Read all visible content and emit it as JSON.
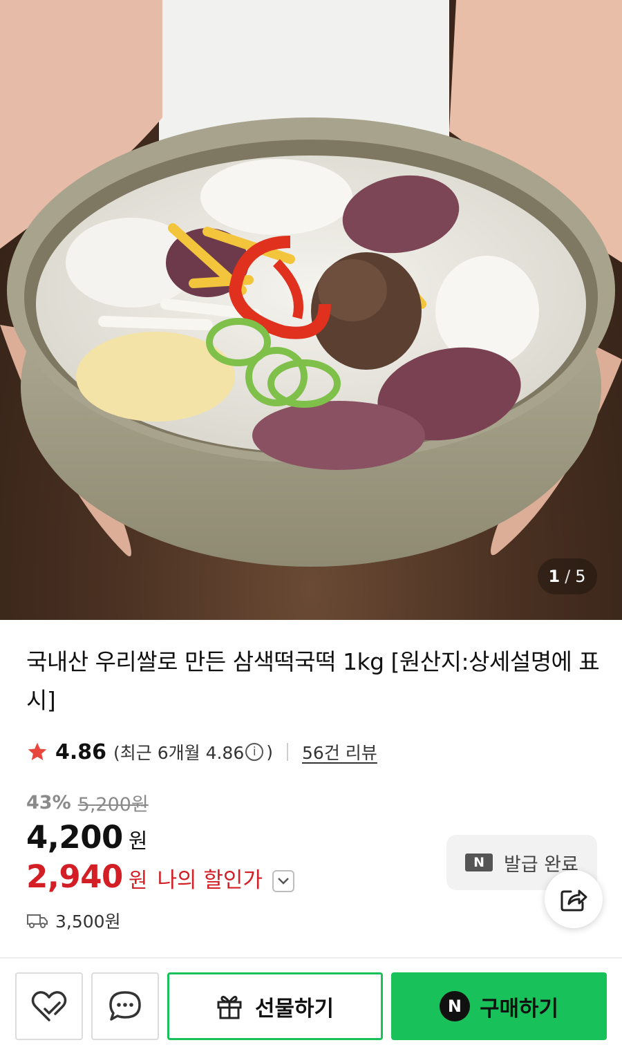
{
  "image": {
    "counter_current": "1",
    "counter_sep": "/",
    "counter_total": "5"
  },
  "product": {
    "title": "국내산 우리쌀로 만든 삼색떡국떡 1kg [원산지:상세설명에 표시]"
  },
  "rating": {
    "score": "4.86",
    "recent_prefix": "(최근 6개월 4.86",
    "recent_suffix": ")",
    "info_icon": "i",
    "reviews": "56건 리뷰"
  },
  "price": {
    "discount_rate": "43%",
    "original": "5,200원",
    "sale": "4,200",
    "sale_unit": "원",
    "my_price": "2,940",
    "my_price_unit": "원",
    "my_price_label": "나의 할인가"
  },
  "shipping": {
    "fee": "3,500원"
  },
  "coupon": {
    "badge": "N",
    "label": "발급 완료"
  },
  "actions": {
    "gift_label": "선물하기",
    "buy_badge": "N",
    "buy_label": "구매하기"
  },
  "icons": {
    "star": "star-icon",
    "info": "info-icon",
    "truck": "truck-icon",
    "share": "share-icon",
    "heart": "heart-icon",
    "chat": "chat-bubble-icon",
    "gift": "gift-icon",
    "chevron": "chevron-down-icon"
  },
  "colors": {
    "accent_green": "#19c15a",
    "discount_red": "#d21e24",
    "star_red": "#e8473e"
  }
}
